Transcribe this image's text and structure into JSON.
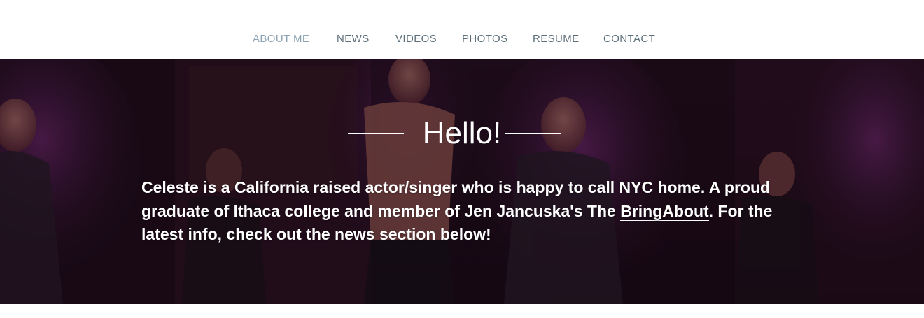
{
  "nav": {
    "items": [
      {
        "label": "ABOUT ME",
        "active": true
      },
      {
        "label": "NEWS",
        "active": false
      },
      {
        "label": "VIDEOS",
        "active": false
      },
      {
        "label": "PHOTOS",
        "active": false
      },
      {
        "label": "RESUME",
        "active": false
      },
      {
        "label": "CONTACT",
        "active": false
      }
    ]
  },
  "hero": {
    "title": "Hello!",
    "bio_before_link": "Celeste is a California raised actor/singer who is happy to call NYC home. A proud graduate of Ithaca college and member of Jen Jancuska's The ",
    "bio_link": "BringAbout",
    "bio_after_link": ". For the latest info, check out the news section below!"
  },
  "colors": {
    "nav_text": "#5c6e7a",
    "nav_active": "#8ea3b3",
    "hero_overlay": "#140812",
    "stage_purple": "#6b1f6b",
    "text_white": "#ffffff"
  }
}
